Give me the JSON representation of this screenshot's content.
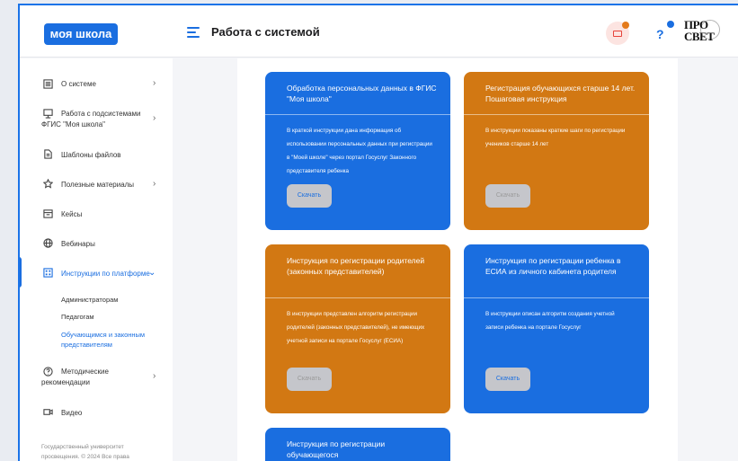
{
  "header": {
    "logo_text": "моя школа",
    "page_title": "Работа с системой",
    "brand_line1": "ПРО",
    "brand_line2": "СВЕТ"
  },
  "sidebar": {
    "items": [
      {
        "label": "О системе",
        "icon": "info-panel-icon",
        "chevron": "›"
      },
      {
        "label": "Работа с подсистемами ФГИС \"Моя школа\"",
        "icon": "monitor-icon",
        "chevron": "›"
      },
      {
        "label": "Шаблоны файлов",
        "icon": "file-icon"
      },
      {
        "label": "Полезные материалы",
        "icon": "star-icon",
        "chevron": "›"
      },
      {
        "label": "Кейсы",
        "icon": "case-icon"
      },
      {
        "label": "Вебинары",
        "icon": "globe-icon"
      },
      {
        "label": "Инструкции по платформе",
        "icon": "building-icon",
        "chevron": "⌄"
      },
      {
        "label": "Методические рекомендации",
        "icon": "question-icon",
        "chevron": "›"
      },
      {
        "label": "Видео",
        "icon": "video-icon"
      }
    ],
    "sub_items": [
      {
        "label": "Администраторам"
      },
      {
        "label": "Педагогам"
      },
      {
        "label": "Обучающимся и законным представителям"
      }
    ],
    "footer": "Государственный университет просвещения. © 2024 Все права"
  },
  "cards": [
    {
      "title": "Обработка персональных данных в ФГИС \"Моя школа\"",
      "description": "В краткой инструкции дана информация об использовании персональных данных при регистрации в \"Моей школе\" через портал Госуслуг Законного представителя ребенка",
      "button": "Скачать",
      "color": "#1a6ee0"
    },
    {
      "title": "Регистрация обучающихся старше 14 лет. Пошаговая инструкция",
      "description": "В инструкции показаны краткие шаги по регистрации учеников старше 14 лет",
      "button": "Скачать",
      "color": "#d27813"
    },
    {
      "title": "Инструкция по регистрации родителей (законных представителей)",
      "description": "В инструкции представлен алгоритм регистрации родителей (законных представителей), не имеющих учетной записи на портале Госуслуг (ЕСИА)",
      "button": "Скачать",
      "color": "#d27813"
    },
    {
      "title": "Инструкция по регистрации ребенка в ЕСИА из личного кабинета родителя",
      "description": "В инструкции описан алгоритм создания учетной записи ребенка на портале Госуслуг",
      "button": "Скачать",
      "color": "#1a6ee0"
    },
    {
      "title": "Инструкция по регистрации обучающегося",
      "color": "#1a6ee0"
    }
  ]
}
